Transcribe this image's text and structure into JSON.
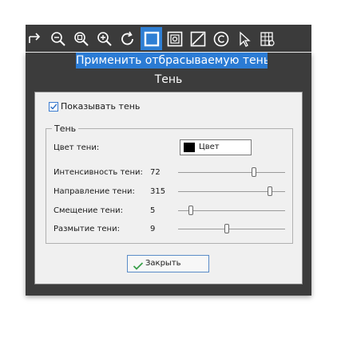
{
  "toolbar": {
    "tools": [
      {
        "icon": "undo-arrow-icon"
      },
      {
        "icon": "zoom-out-icon"
      },
      {
        "icon": "zoom-fit-icon"
      },
      {
        "icon": "zoom-in-icon"
      },
      {
        "icon": "rotate-icon"
      },
      {
        "icon": "shadow-square-icon",
        "active": true
      },
      {
        "icon": "frame-icon"
      },
      {
        "icon": "crop-diagonal-icon"
      },
      {
        "icon": "copyright-icon"
      },
      {
        "icon": "pointer-icon"
      },
      {
        "icon": "grid-settings-icon"
      }
    ]
  },
  "tooltip": "Применить отбрасываемую тень",
  "dialog": {
    "title": "Тень",
    "show_shadow_label": "Показывать тень",
    "show_shadow_checked": true,
    "group_label": "Тень",
    "shadow_color_label": "Цвет тени:",
    "color_button_label": "Цвет",
    "shadow_color": "#000000",
    "intensity": {
      "label": "Интенсивность тени:",
      "value": "72",
      "min": 0,
      "max": 100
    },
    "direction": {
      "label": "Направление тени:",
      "value": "315",
      "min": 0,
      "max": 360
    },
    "offset": {
      "label": "Смещение тени:",
      "value": "5",
      "min": 0,
      "max": 50
    },
    "blur": {
      "label": "Размытие тени:",
      "value": "9",
      "min": 0,
      "max": 20
    },
    "close_label": "Закрыть"
  },
  "colors": {
    "accent": "#2b7bd4",
    "toolbar_bg": "#3b3b3b",
    "panel_bg": "#f0f0f0"
  }
}
